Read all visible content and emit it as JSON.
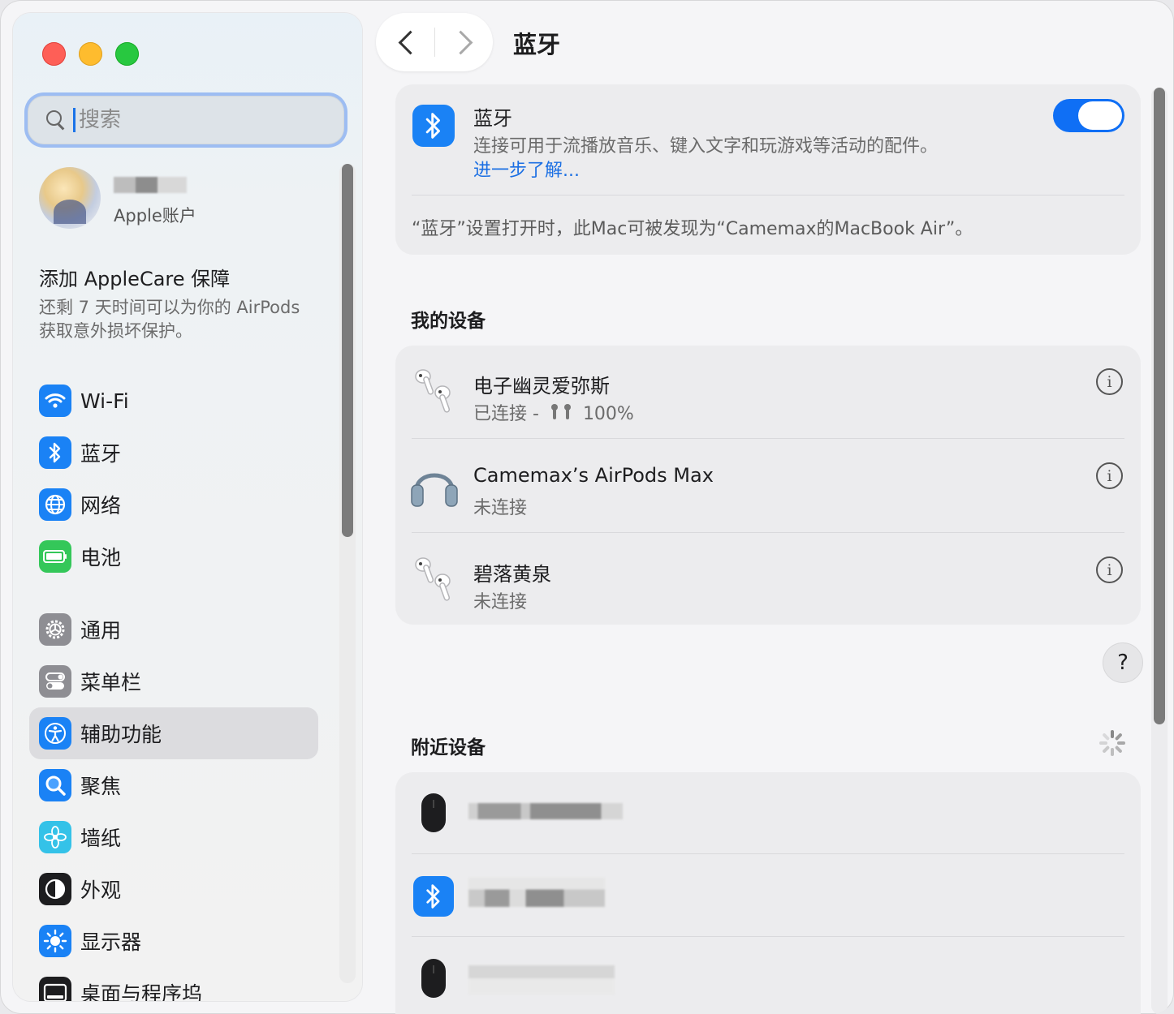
{
  "search": {
    "placeholder": "搜索"
  },
  "account": {
    "label": "Apple账户"
  },
  "applecare": {
    "title": "添加 AppleCare 保障",
    "desc_line1": "还剩 7 天时间可以为你的 AirPods",
    "desc_line2": "获取意外损坏保护。"
  },
  "sidebar": {
    "items": [
      {
        "label": "Wi-Fi",
        "icon": "wifi-icon",
        "color": "#1a82f5"
      },
      {
        "label": "蓝牙",
        "icon": "bluetooth-icon",
        "color": "#1a82f5"
      },
      {
        "label": "网络",
        "icon": "globe-icon",
        "color": "#1a82f5"
      },
      {
        "label": "电池",
        "icon": "battery-icon",
        "color": "#34c759"
      },
      {
        "label": "通用",
        "icon": "gear-icon",
        "color": "#8e8e93"
      },
      {
        "label": "菜单栏",
        "icon": "menubar-icon",
        "color": "#8e8e93"
      },
      {
        "label": "辅助功能",
        "icon": "accessibility-icon",
        "color": "#1a82f5"
      },
      {
        "label": "聚焦",
        "icon": "spotlight-icon",
        "color": "#1a82f5"
      },
      {
        "label": "墙纸",
        "icon": "wallpaper-icon",
        "color": "#34c2e8"
      },
      {
        "label": "外观",
        "icon": "appearance-icon",
        "color": "#1d1d1f"
      },
      {
        "label": "显示器",
        "icon": "display-icon",
        "color": "#1a82f5"
      },
      {
        "label": "桌面与程序坞",
        "icon": "dock-icon",
        "color": "#1d1d1f"
      }
    ],
    "selected": "辅助功能"
  },
  "header": {
    "title": "蓝牙"
  },
  "bluetooth": {
    "title": "蓝牙",
    "desc": "连接可用于流播放音乐、键入文字和玩游戏等活动的配件。",
    "link": "进一步了解...",
    "enabled": true,
    "note": "“蓝牙”设置打开时，此Mac可被发现为“Camemax的MacBook Air”。"
  },
  "my_devices": {
    "heading": "我的设备",
    "items": [
      {
        "name": "电子幽灵爱弥斯",
        "status": "已连接 -",
        "battery": "100%",
        "icon": "airpods-icon"
      },
      {
        "name": "Camemax’s AirPods Max",
        "status": "未连接",
        "icon": "airpods-max-icon"
      },
      {
        "name": "碧落黄泉",
        "status": "未连接",
        "icon": "airpods-icon"
      }
    ]
  },
  "nearby": {
    "heading": "附近设备",
    "items": [
      {
        "icon": "mouse-icon"
      },
      {
        "icon": "bluetooth-icon"
      },
      {
        "icon": "mouse-icon"
      }
    ]
  },
  "help_label": "?"
}
